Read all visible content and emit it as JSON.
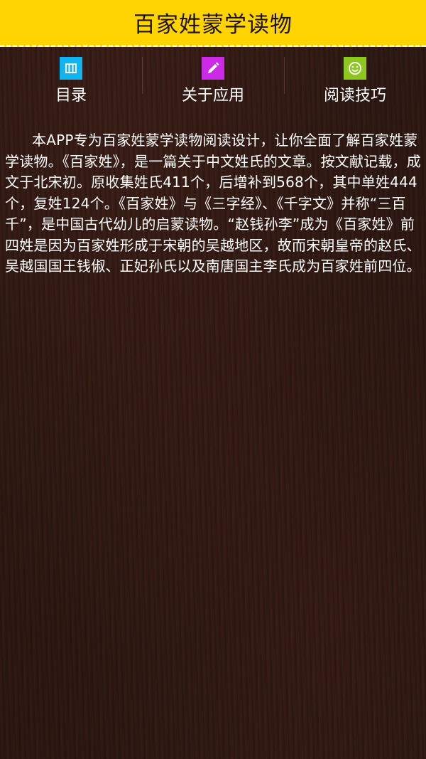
{
  "app": {
    "title": "百家姓蒙学读物"
  },
  "nav": {
    "items": [
      {
        "label": "目录",
        "icon": "catalog-icon",
        "icon_color": "#12b4f0"
      },
      {
        "label": "关于应用",
        "icon": "edit-icon",
        "icon_color": "#cc2ae8"
      },
      {
        "label": "阅读技巧",
        "icon": "smiley-icon",
        "icon_color": "#8cc81e"
      }
    ]
  },
  "content": {
    "paragraph": "本APP专为百家姓蒙学读物阅读设计，让你全面了解百家姓蒙学读物。《百家姓》，是一篇关于中文姓氏的文章。按文献记载，成文于北宋初。原收集姓氏411个，后增补到568个，其中单姓444个，复姓124个。《百家姓》与《三字经》、《千字文》并称“三百千”，是中国古代幼儿的启蒙读物。“赵钱孙李”成为《百家姓》前四姓是因为百家姓形成于宋朝的吴越地区，故而宋朝皇帝的赵氏、吴越国国王钱俶、正妃孙氏以及南唐国主李氏成为百家姓前四位。"
  },
  "colors": {
    "titlebar_bg": "#ffd400",
    "text": "#ffffff",
    "background": "#2a1711"
  }
}
